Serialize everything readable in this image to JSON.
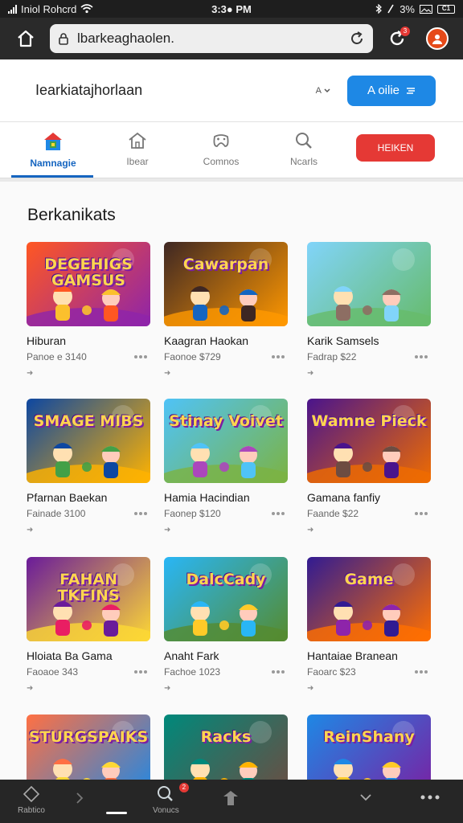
{
  "status_bar": {
    "carrier": "Iniol Rohcrd",
    "time": "3:3● PM",
    "battery_text": "3%",
    "battery_level": "C1"
  },
  "browser": {
    "url": "lbarkeaghaolen.",
    "notification_count": "3"
  },
  "header": {
    "site_title": "Iearkiatajhorlaan",
    "sort_label": "A",
    "primary_button": "A oilie"
  },
  "tabs": [
    {
      "label": "Namnagie",
      "icon": "store-icon",
      "active": true
    },
    {
      "label": "Ibear",
      "icon": "home-icon",
      "active": false
    },
    {
      "label": "Comnos",
      "icon": "gamepad-icon",
      "active": false
    },
    {
      "label": "Ncarls",
      "icon": "search-icon",
      "active": false
    }
  ],
  "red_button": "HEIKEN",
  "section_title": "Berkanikats",
  "games": [
    {
      "title": "Hiburan",
      "price": "Panoe e 3140",
      "thumb_text": "DEGEHIGS GAMSUS",
      "palette": [
        "#ff5722",
        "#8e24aa",
        "#fbc02d"
      ]
    },
    {
      "title": "Kaagran Haokan",
      "price": "Faonoe $729",
      "thumb_text": "Cawarpan",
      "palette": [
        "#3e2723",
        "#ff9800",
        "#1565c0"
      ]
    },
    {
      "title": "Karik Samsels",
      "price": "Fadrap $22",
      "thumb_text": "",
      "palette": [
        "#81d4fa",
        "#66bb6a",
        "#8d6e63"
      ]
    },
    {
      "title": "Pfarnan Baekan",
      "price": "Fainade 3100",
      "thumb_text": "SMAGE MIBS",
      "palette": [
        "#0d47a1",
        "#ffb300",
        "#43a047"
      ]
    },
    {
      "title": "Hamia Hacindian",
      "price": "Faonep $120",
      "thumb_text": "Stinay Voivet",
      "palette": [
        "#4fc3f7",
        "#7cb342",
        "#ab47bc"
      ]
    },
    {
      "title": "Gamana fanfiy",
      "price": "Faande $22",
      "thumb_text": "Wamne Pieck",
      "palette": [
        "#4a148c",
        "#ef6c00",
        "#6d4c41"
      ]
    },
    {
      "title": "Hloiata Ba Gama",
      "price": "Faoaoe 343",
      "thumb_text": "FAHAN TKFINS",
      "palette": [
        "#6a1b9a",
        "#fdd835",
        "#e91e63"
      ]
    },
    {
      "title": "Anaht Fark",
      "price": "Fachoe 1023",
      "thumb_text": "DalcCady",
      "palette": [
        "#29b6f6",
        "#558b2f",
        "#ffca28"
      ]
    },
    {
      "title": "Hantaiae Branean",
      "price": "Faoarc $23",
      "thumb_text": "Game",
      "palette": [
        "#311b92",
        "#ff6f00",
        "#8e24aa"
      ]
    },
    {
      "title": "",
      "price": "",
      "thumb_text": "STURGSPAIKS",
      "palette": [
        "#ff7043",
        "#1e88e5",
        "#fdd835"
      ]
    },
    {
      "title": "",
      "price": "",
      "thumb_text": "Racks",
      "palette": [
        "#00897b",
        "#6d4c41",
        "#ffb300"
      ]
    },
    {
      "title": "",
      "price": "",
      "thumb_text": "ReinShany",
      "palette": [
        "#1e88e5",
        "#7b1fa2",
        "#ffca28"
      ]
    }
  ],
  "bottom_bar": {
    "items": [
      {
        "label": "Rabtico",
        "icon": "shapes-icon"
      },
      {
        "label": "",
        "icon": "chevron-right-icon"
      },
      {
        "label": "Vonucs",
        "icon": "search-icon",
        "badge": "2"
      },
      {
        "label": "",
        "icon": "upload-icon"
      },
      {
        "label": "",
        "icon": "chevron-down-icon"
      },
      {
        "label": "",
        "icon": "more-icon"
      }
    ]
  }
}
